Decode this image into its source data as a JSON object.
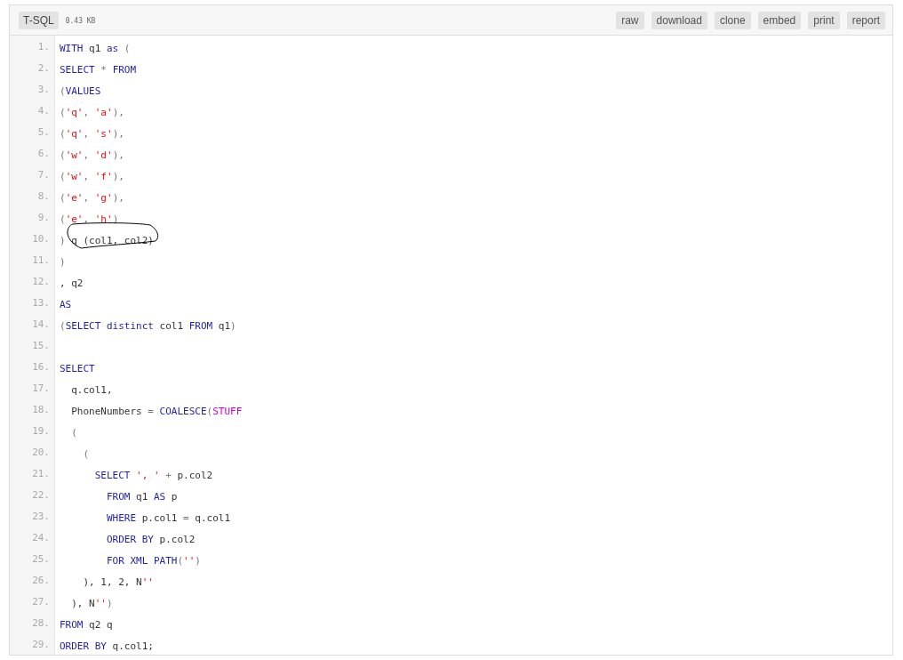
{
  "header": {
    "language": "T-SQL",
    "size": "0.43 KB",
    "buttons": [
      "raw",
      "download",
      "clone",
      "embed",
      "print",
      "report"
    ]
  },
  "lines": [
    {
      "number": "1.",
      "tokens": [
        {
          "kind": "kw",
          "text": "WITH"
        },
        {
          "kind": "plain",
          "text": " q1 "
        },
        {
          "kind": "kw",
          "text": "as"
        },
        {
          "kind": "pun",
          "text": " ("
        }
      ]
    },
    {
      "number": "2.",
      "tokens": [
        {
          "kind": "kw",
          "text": "SELECT"
        },
        {
          "kind": "pun",
          "text": " * "
        },
        {
          "kind": "kw",
          "text": "FROM"
        }
      ]
    },
    {
      "number": "3.",
      "tokens": [
        {
          "kind": "pun",
          "text": "("
        },
        {
          "kind": "kw",
          "text": "VALUES"
        }
      ]
    },
    {
      "number": "4.",
      "tokens": [
        {
          "kind": "pun",
          "text": "("
        },
        {
          "kind": "str",
          "text": "'q'"
        },
        {
          "kind": "pun",
          "text": ", "
        },
        {
          "kind": "str",
          "text": "'a'"
        },
        {
          "kind": "pun",
          "text": "),"
        }
      ]
    },
    {
      "number": "5.",
      "tokens": [
        {
          "kind": "pun",
          "text": "("
        },
        {
          "kind": "str",
          "text": "'q'"
        },
        {
          "kind": "pun",
          "text": ", "
        },
        {
          "kind": "str",
          "text": "'s'"
        },
        {
          "kind": "pun",
          "text": "),"
        }
      ]
    },
    {
      "number": "6.",
      "tokens": [
        {
          "kind": "pun",
          "text": "("
        },
        {
          "kind": "str",
          "text": "'w'"
        },
        {
          "kind": "pun",
          "text": ", "
        },
        {
          "kind": "str",
          "text": "'d'"
        },
        {
          "kind": "pun",
          "text": "),"
        }
      ]
    },
    {
      "number": "7.",
      "tokens": [
        {
          "kind": "pun",
          "text": "("
        },
        {
          "kind": "str",
          "text": "'w'"
        },
        {
          "kind": "pun",
          "text": ", "
        },
        {
          "kind": "str",
          "text": "'f'"
        },
        {
          "kind": "pun",
          "text": "),"
        }
      ]
    },
    {
      "number": "8.",
      "tokens": [
        {
          "kind": "pun",
          "text": "("
        },
        {
          "kind": "str",
          "text": "'e'"
        },
        {
          "kind": "pun",
          "text": ", "
        },
        {
          "kind": "str",
          "text": "'g'"
        },
        {
          "kind": "pun",
          "text": "),"
        }
      ]
    },
    {
      "number": "9.",
      "tokens": [
        {
          "kind": "pun",
          "text": "("
        },
        {
          "kind": "str",
          "text": "'e'"
        },
        {
          "kind": "pun",
          "text": ", "
        },
        {
          "kind": "str",
          "text": "'h'"
        },
        {
          "kind": "pun",
          "text": ")"
        }
      ]
    },
    {
      "number": "10.",
      "tokens": [
        {
          "kind": "pun",
          "text": ") "
        },
        {
          "kind": "plain",
          "text": "q (col1, col2)",
          "circled": true
        }
      ]
    },
    {
      "number": "11.",
      "tokens": [
        {
          "kind": "pun",
          "text": ")"
        }
      ]
    },
    {
      "number": "12.",
      "tokens": [
        {
          "kind": "plain",
          "text": ", q2"
        }
      ]
    },
    {
      "number": "13.",
      "tokens": [
        {
          "kind": "kw",
          "text": "AS"
        }
      ]
    },
    {
      "number": "14.",
      "tokens": [
        {
          "kind": "pun",
          "text": "("
        },
        {
          "kind": "kw",
          "text": "SELECT distinct"
        },
        {
          "kind": "plain",
          "text": " col1 "
        },
        {
          "kind": "kw",
          "text": "FROM"
        },
        {
          "kind": "plain",
          "text": " q1"
        },
        {
          "kind": "pun",
          "text": ")"
        }
      ]
    },
    {
      "number": "15."
    },
    {
      "number": "16.",
      "tokens": [
        {
          "kind": "kw",
          "text": "SELECT"
        }
      ]
    },
    {
      "number": "17.",
      "tokens": [
        {
          "kind": "plain",
          "text": "  q.col1,"
        }
      ]
    },
    {
      "number": "18.",
      "tokens": [
        {
          "kind": "plain",
          "text": "  PhoneNumbers "
        },
        {
          "kind": "pun",
          "text": "= "
        },
        {
          "kind": "kw",
          "text": "COALESCE"
        },
        {
          "kind": "pun",
          "text": "("
        },
        {
          "kind": "fn",
          "text": "STUFF"
        }
      ]
    },
    {
      "number": "19.",
      "tokens": [
        {
          "kind": "pun",
          "text": "  ("
        }
      ]
    },
    {
      "number": "20.",
      "tokens": [
        {
          "kind": "pun",
          "text": "    ("
        }
      ]
    },
    {
      "number": "21.",
      "tokens": [
        {
          "kind": "kw",
          "text": "      SELECT "
        },
        {
          "kind": "str",
          "text": "', '"
        },
        {
          "kind": "pun",
          "text": " + "
        },
        {
          "kind": "plain",
          "text": "p.col2"
        }
      ]
    },
    {
      "number": "22.",
      "tokens": [
        {
          "kind": "kw",
          "text": "        FROM"
        },
        {
          "kind": "plain",
          "text": " q1 "
        },
        {
          "kind": "kw",
          "text": "AS"
        },
        {
          "kind": "plain",
          "text": " p"
        }
      ]
    },
    {
      "number": "23.",
      "tokens": [
        {
          "kind": "kw",
          "text": "        WHERE"
        },
        {
          "kind": "plain",
          "text": " p.col1 "
        },
        {
          "kind": "pun",
          "text": "= "
        },
        {
          "kind": "plain",
          "text": "q.col1"
        }
      ]
    },
    {
      "number": "24.",
      "tokens": [
        {
          "kind": "kw",
          "text": "        ORDER BY"
        },
        {
          "kind": "plain",
          "text": " p.col2"
        }
      ]
    },
    {
      "number": "25.",
      "tokens": [
        {
          "kind": "kw",
          "text": "        FOR XML PATH"
        },
        {
          "kind": "pun",
          "text": "("
        },
        {
          "kind": "str",
          "text": "''"
        },
        {
          "kind": "pun",
          "text": ")"
        }
      ]
    },
    {
      "number": "26.",
      "tokens": [
        {
          "kind": "plain",
          "text": "    ), 1, 2, N"
        },
        {
          "kind": "str",
          "text": "''"
        }
      ]
    },
    {
      "number": "27.",
      "tokens": [
        {
          "kind": "plain",
          "text": "  ), N"
        },
        {
          "kind": "str",
          "text": "''"
        },
        {
          "kind": "pun",
          "text": ")"
        }
      ]
    },
    {
      "number": "28.",
      "tokens": [
        {
          "kind": "kw",
          "text": "FROM"
        },
        {
          "kind": "plain",
          "text": " q2 q"
        }
      ]
    },
    {
      "number": "29.",
      "tokens": [
        {
          "kind": "kw",
          "text": "ORDER BY"
        },
        {
          "kind": "plain",
          "text": " q.col1;"
        }
      ]
    }
  ]
}
